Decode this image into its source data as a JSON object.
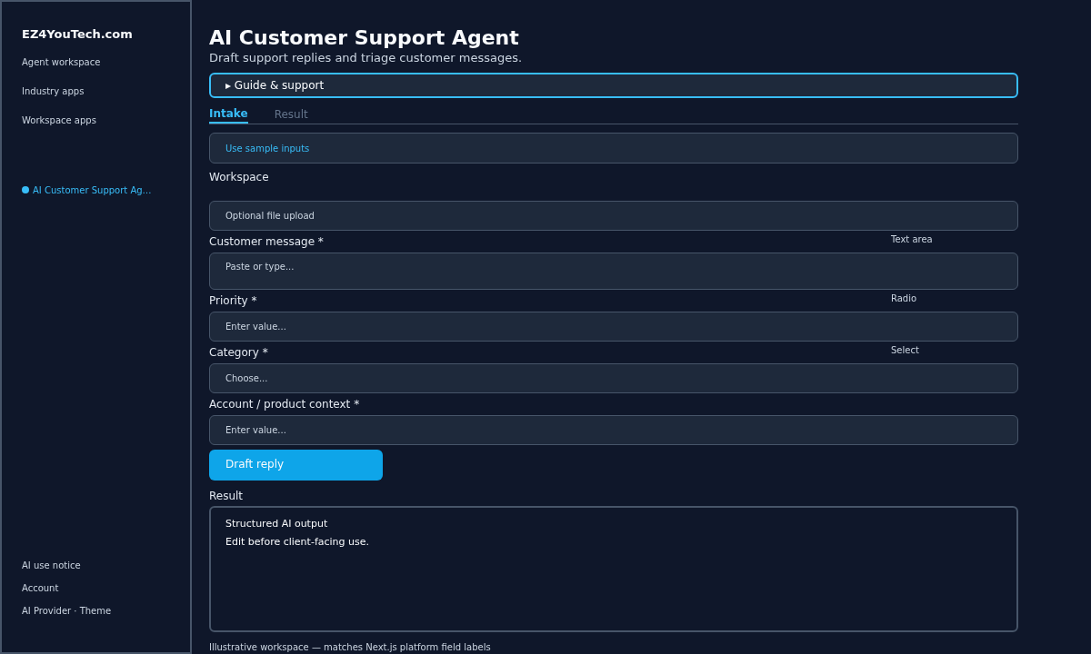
{
  "sidebar": {
    "brand": "EZ4YouTech.com",
    "items": [
      {
        "label": "Agent workspace",
        "selected": false
      },
      {
        "label": "Industry apps",
        "selected": false
      },
      {
        "label": "Workspace apps",
        "selected": false
      }
    ],
    "current": {
      "label": "AI Customer Support Ag…",
      "selected": true
    },
    "footer": [
      "AI use notice",
      "Account",
      "AI Provider · Theme"
    ]
  },
  "page": {
    "title": "AI Customer Support Agent",
    "subtitle": "Draft support replies and triage customer messages."
  },
  "guide": {
    "label": "Guide & support",
    "marker": "▸",
    "expanded": false
  },
  "tabs": [
    {
      "label": "Intake",
      "selected": true
    },
    {
      "label": "Result",
      "selected": false
    }
  ],
  "sample_link": "Use sample inputs",
  "fields": [
    {
      "kind": "upload",
      "label": "Workspace",
      "placeholder": "Optional file upload"
    },
    {
      "kind": "textarea",
      "label": "Customer message *",
      "hint": "Text area",
      "placeholder": "Paste or type..."
    },
    {
      "kind": "input",
      "label": "Priority *",
      "hint": "Radio",
      "placeholder": "Enter value..."
    },
    {
      "kind": "select",
      "label": "Category *",
      "hint": "Select",
      "placeholder": "Choose..."
    },
    {
      "kind": "input",
      "label": "Account / product context *",
      "placeholder": "Enter value..."
    }
  ],
  "submit": "Draft reply",
  "result": {
    "label": "Result",
    "lines": [
      "Structured AI output",
      "Edit before client-facing use."
    ]
  },
  "footnote": "Illustrative workspace — matches Next.js platform field labels"
}
